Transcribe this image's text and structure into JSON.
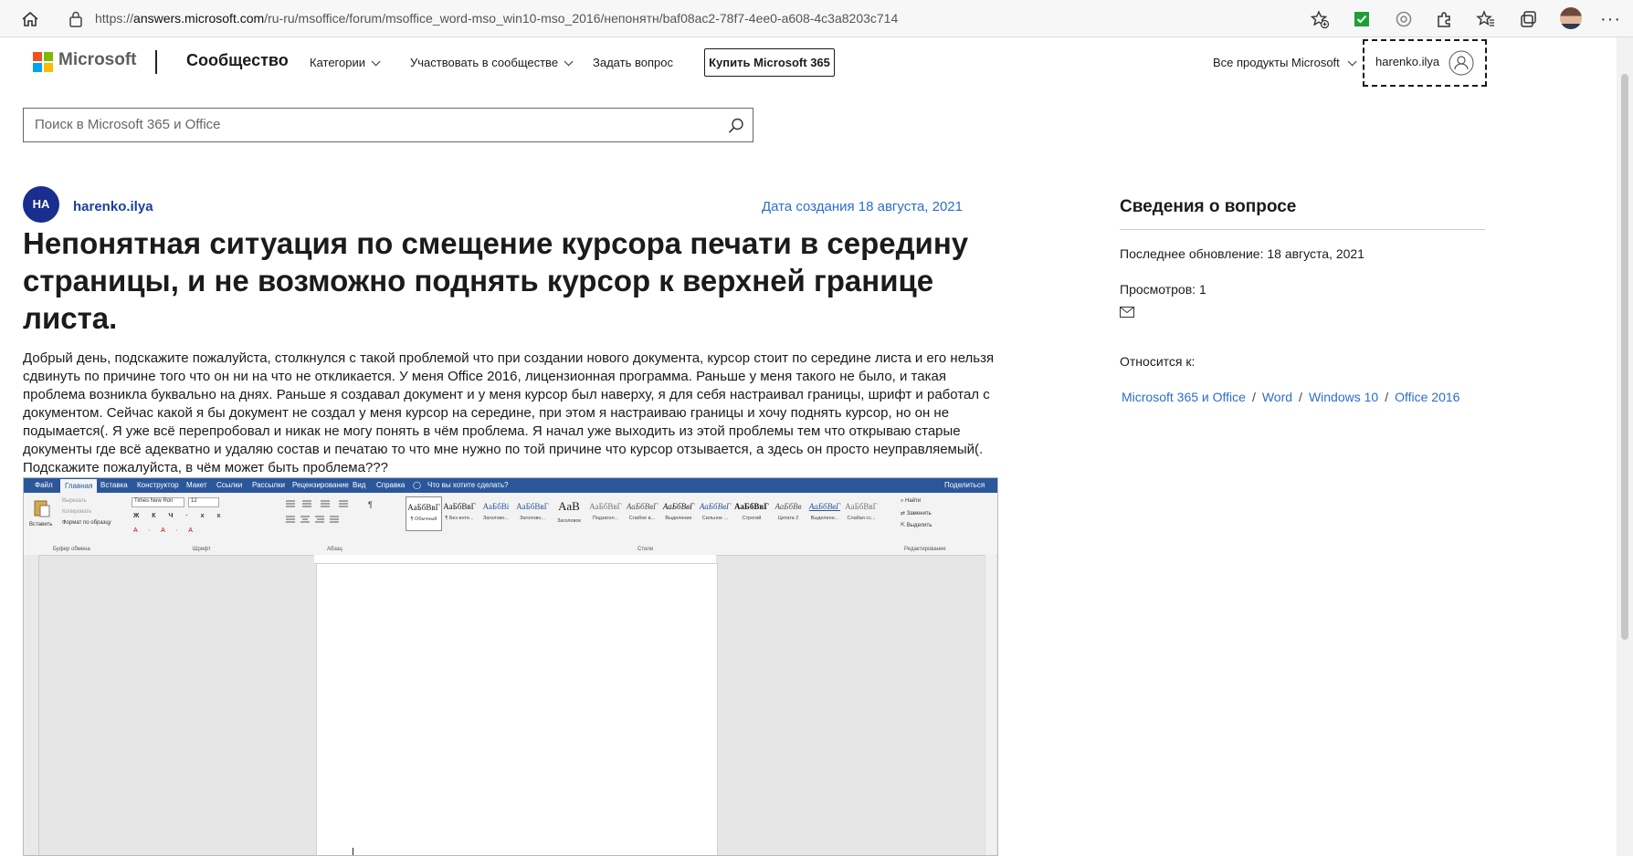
{
  "browser": {
    "url_prefix": "https://",
    "url_host": "answers.microsoft.com",
    "url_path": "/ru-ru/msoffice/forum/msoffice_word-mso_win10-mso_2016/непонятн/baf08ac2-78f7-4ee0-a608-4c3a8203c714"
  },
  "header": {
    "brand": "Microsoft",
    "community": "Сообщество",
    "nav": {
      "categories": "Категории",
      "participate": "Участвовать в сообществе",
      "ask": "Задать вопрос"
    },
    "buy_button": "Купить Microsoft 365",
    "all_products": "Все продукты Microsoft",
    "username": "harenko.ilya"
  },
  "search": {
    "placeholder": "Поиск в Microsoft 365 и Office"
  },
  "question": {
    "avatar_initials": "HA",
    "author": "harenko.ilya",
    "created": "Дата создания 18 августа, 2021",
    "title": "Непонятная ситуация по смещение курсора печати в середину страницы, и не возможно поднять курсор к верхней границе листа.",
    "body": "Добрый день, подскажите пожалуйста, столкнулся с такой проблемой что при создании нового документа, курсор стоит по середине листа и его нельзя сдвинуть по причине того что он ни на что не откликается. У меня Office 2016, лицензионная программа. Раньше у меня такого не было, и такая проблема возникла буквально на днях. Раньше я создавал документ и у меня курсор был наверху, я для себя настраивал границы, шрифт и работал с документом. Сейчас какой я бы документ не создал у меня курсор на середине, при этом я настраиваю границы и хочу поднять курсор, но он не подымается(. Я уже всё перепробовал и никак не могу понять в чём проблема. Я начал уже выходить из этой проблемы тем что открываю старые документы где всё адекватно и удаляю состав и печатаю то что мне нужно по той причине что курсор отзывается, а здесь он просто неуправляемый(. Подскажите пожалуйста, в чём может быть проблема???"
  },
  "word_screenshot": {
    "tabs": [
      "Файл",
      "Главная",
      "Вставка",
      "Конструктор",
      "Макет",
      "Ссылки",
      "Рассылки",
      "Рецензирование",
      "Вид",
      "Справка"
    ],
    "tell_me": "Что вы хотите сделать?",
    "share": "Поделиться",
    "clipboard": {
      "paste": "Вставить",
      "cut": "Вырезать",
      "copy": "Копировать",
      "format_painter": "Формат по образцу",
      "label": "Буфер обмена"
    },
    "font": {
      "name": "Times New Ron",
      "size": "12",
      "label": "Шрифт"
    },
    "paragraph_label": "Абзац",
    "styles_label": "Стили",
    "editing": {
      "find": "Найти",
      "replace": "Заменить",
      "select": "Выделить",
      "label": "Редактирование"
    },
    "styles": [
      {
        "sample": "АаБбВвГ",
        "name": "¶ Обычный"
      },
      {
        "sample": "АаБбВвГ",
        "name": "¶ Без инте..."
      },
      {
        "sample": "АаБбВі",
        "name": "Заголово..."
      },
      {
        "sample": "АаБбВвГ",
        "name": "Заголово..."
      },
      {
        "sample": "АаВ",
        "name": "Заголовок"
      },
      {
        "sample": "АаБбВвГ",
        "name": "Подзагол..."
      },
      {
        "sample": "АаБбВвГ",
        "name": "Слабое в..."
      },
      {
        "sample": "АаБбВвГ",
        "name": "Выделение"
      },
      {
        "sample": "АаБбВвГ",
        "name": "Сильное ..."
      },
      {
        "sample": "АаБбВвГ",
        "name": "Строгий"
      },
      {
        "sample": "АаБбВв",
        "name": "Цитата 2"
      },
      {
        "sample": "АаБбВвГ",
        "name": "Выделенн..."
      },
      {
        "sample": "АаБбВвГ",
        "name": "Слабая сс..."
      }
    ]
  },
  "sidebar": {
    "title": "Сведения о вопросе",
    "updated": "Последнее обновление: 18 августа, 2021",
    "views": "Просмотров: 1",
    "applies_to": "Относится к:",
    "tags": [
      "Microsoft 365 и Office",
      "Word",
      "Windows 10",
      "Office 2016"
    ]
  },
  "colors": {
    "link": "#2a6ecf",
    "word_blue": "#2b579a",
    "avatar": "#1a2e8f"
  }
}
